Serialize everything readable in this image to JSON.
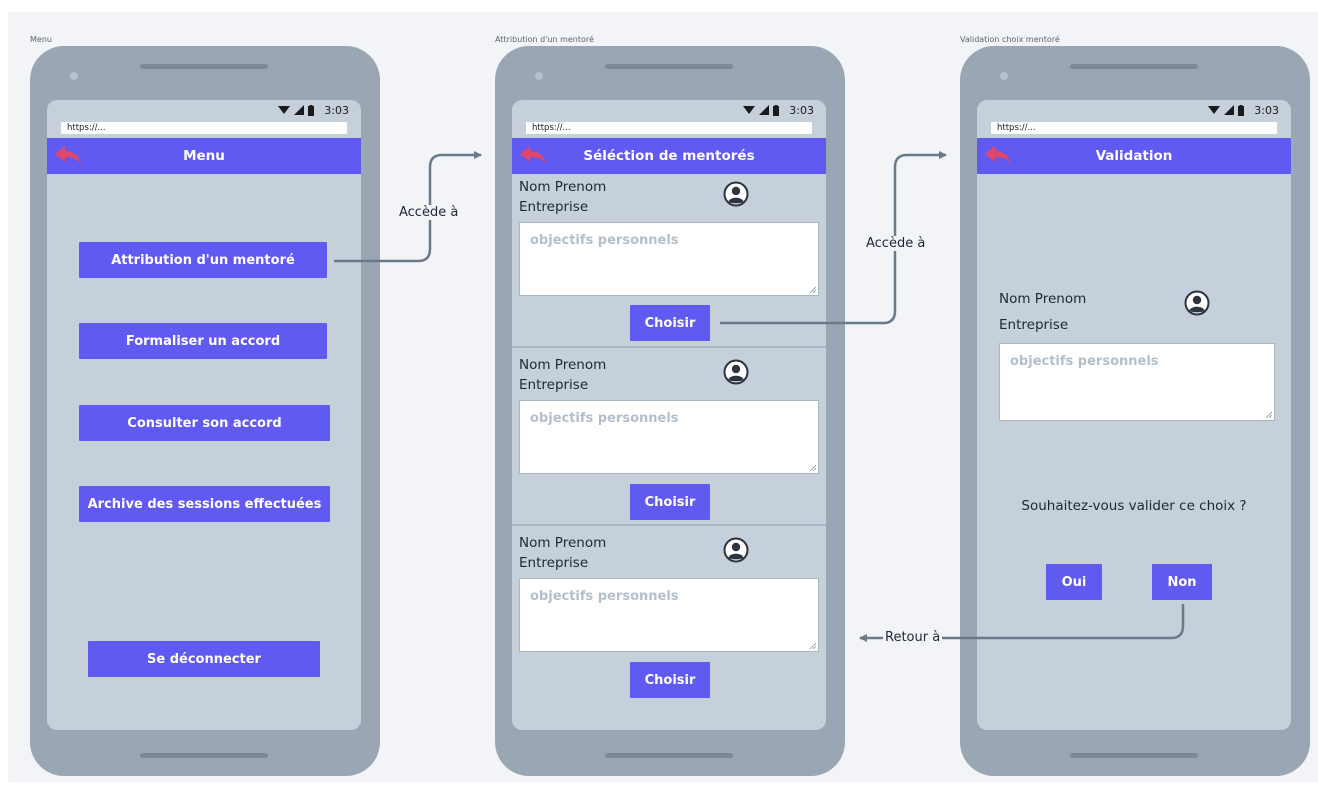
{
  "screens": {
    "menu": {
      "label": "Menu",
      "status_time": "3:03",
      "url": "https://...",
      "title": "Menu",
      "buttons": [
        "Attribution d'un mentoré",
        "Formaliser un accord",
        "Consulter son accord",
        "Archive des sessions effectuées",
        "Se déconnecter"
      ]
    },
    "selection": {
      "label": "Attribution d'un mentoré",
      "status_time": "3:03",
      "url": "https://...",
      "title": "Séléction de mentorés",
      "cards": [
        {
          "name": "Nom Prenom",
          "company": "Entreprise",
          "placeholder": "objectifs personnels",
          "button": "Choisir"
        },
        {
          "name": "Nom Prenom",
          "company": "Entreprise",
          "placeholder": "objectifs personnels",
          "button": "Choisir"
        },
        {
          "name": "Nom Prenom",
          "company": "Entreprise",
          "placeholder": "objectifs personnels",
          "button": "Choisir"
        }
      ]
    },
    "validation": {
      "label": "Validation choix mentoré",
      "status_time": "3:03",
      "url": "https://...",
      "title": "Validation",
      "name": "Nom Prenom",
      "company": "Entreprise",
      "placeholder": "objectifs personnels",
      "question": "Souhaitez-vous valider ce choix ?",
      "yes": "Oui",
      "no": "Non"
    }
  },
  "flows": {
    "to_selection": "Accède à",
    "to_validation": "Accède à",
    "back": "Retour à"
  },
  "colors": {
    "accent": "#6059f2",
    "phone": "#9aa6b3",
    "screen": "#c5d0da",
    "back_arrow": "#e0476a",
    "connector": "#6b7a8a"
  }
}
